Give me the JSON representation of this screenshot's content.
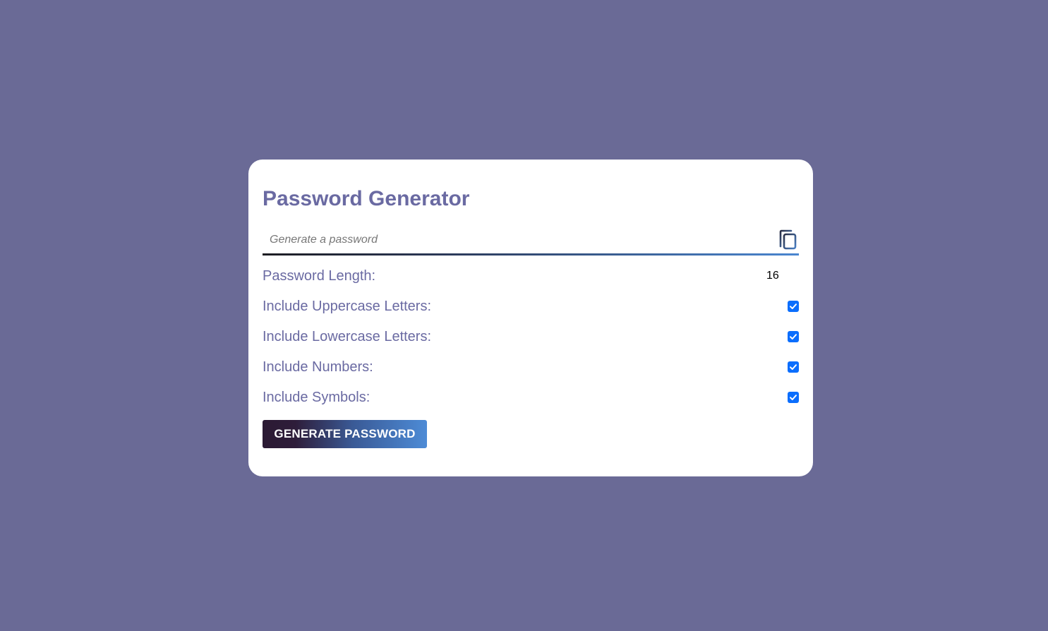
{
  "app": {
    "title": "Password Generator"
  },
  "password": {
    "value": "",
    "placeholder": "Generate a password",
    "copy_icon": "copy-icon"
  },
  "options": {
    "length_label": "Password Length:",
    "length_value": "16",
    "uppercase_label": "Include Uppercase Letters:",
    "uppercase_checked": true,
    "lowercase_label": "Include Lowercase Letters:",
    "lowercase_checked": true,
    "numbers_label": "Include Numbers:",
    "numbers_checked": true,
    "symbols_label": "Include Symbols:",
    "symbols_checked": true
  },
  "actions": {
    "generate_label": "GENERATE PASSWORD"
  },
  "colors": {
    "background": "#6a6a96",
    "card": "#ffffff",
    "accent_text": "#6a6aa2",
    "checkbox": "#0b6efd"
  }
}
